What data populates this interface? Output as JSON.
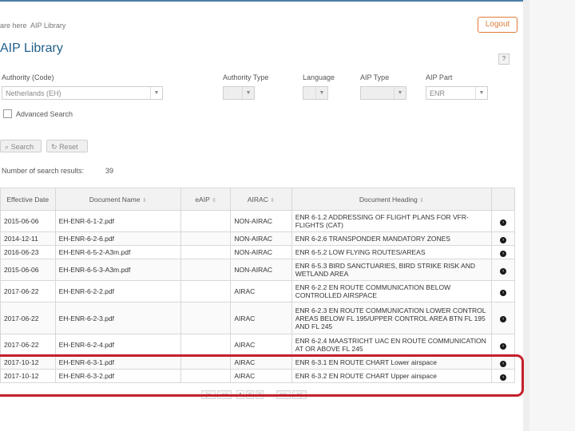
{
  "breadcrumb": {
    "prefix": "are here",
    "current": "AIP Library"
  },
  "header": {
    "logout_label": "Logout",
    "help_label": "?"
  },
  "page": {
    "title": "AIP Library"
  },
  "filters": {
    "authority": {
      "label": "Authority (Code)",
      "value": "Netherlands (EH)"
    },
    "authority_type": {
      "label": "Authority Type",
      "value": ""
    },
    "language": {
      "label": "Language",
      "value": ""
    },
    "aip_type": {
      "label": "AIP Type",
      "value": ""
    },
    "aip_part": {
      "label": "AIP Part",
      "value": "ENR"
    },
    "advanced_search_label": "Advanced Search"
  },
  "actions": {
    "search_label": "Search",
    "reset_label": "Reset"
  },
  "results": {
    "label": "Number of search results:",
    "count": "39"
  },
  "table": {
    "headers": [
      "Effective Date",
      "Document Name",
      "eAIP",
      "AIRAC",
      "Document Heading"
    ],
    "rows": [
      {
        "date": "2015-06-06",
        "doc": "EH-ENR-6-1-2.pdf",
        "eaip": "",
        "airac": "NON-AIRAC",
        "heading": "ENR 6-1.2 ADDRESSING OF FLIGHT PLANS FOR VFR-FLIGHTS (CAT)"
      },
      {
        "date": "2014-12-11",
        "doc": "EH-ENR-6-2-6.pdf",
        "eaip": "",
        "airac": "NON-AIRAC",
        "heading": "ENR 6-2.6 TRANSPONDER MANDATORY ZONES"
      },
      {
        "date": "2016-06-23",
        "doc": "EH-ENR-6-5-2-A3m.pdf",
        "eaip": "",
        "airac": "NON-AIRAC",
        "heading": "ENR 6-5.2 LOW FLYING ROUTES/AREAS"
      },
      {
        "date": "2015-06-06",
        "doc": "EH-ENR-6-5-3-A3m.pdf",
        "eaip": "",
        "airac": "NON-AIRAC",
        "heading": "ENR 6-5.3 BIRD SANCTUARIES, BIRD STRIKE RISK AND WETLAND AREA"
      },
      {
        "date": "2017-06-22",
        "doc": "EH-ENR-6-2-2.pdf",
        "eaip": "",
        "airac": "AIRAC",
        "heading": "ENR 6-2.2 EN ROUTE COMMUNICATION BELOW CONTROLLED AIRSPACE"
      },
      {
        "date": "2017-06-22",
        "doc": "EH-ENR-6-2-3.pdf",
        "eaip": "",
        "airac": "AIRAC",
        "heading": "ENR 6-2.3 EN ROUTE COMMUNICATION LOWER CONTROL AREAS BELOW FL 195/UPPER CONTROL AREA BTN FL 195 AND FL 245"
      },
      {
        "date": "2017-06-22",
        "doc": "EH-ENR-6-2-4.pdf",
        "eaip": "",
        "airac": "AIRAC",
        "heading": "ENR 6-2.4 MAASTRICHT UAC EN ROUTE COMMUNICATION AT OR ABOVE FL 245"
      },
      {
        "date": "2017-10-12",
        "doc": "EH-ENR-6-3-1.pdf",
        "eaip": "",
        "airac": "AIRAC",
        "heading": "ENR 6-3.1 EN ROUTE CHART Lower airspace"
      },
      {
        "date": "2017-10-12",
        "doc": "EH-ENR-6-3-2.pdf",
        "eaip": "",
        "airac": "AIRAC",
        "heading": "ENR 6-3.2 EN ROUTE CHART Upper airspace"
      }
    ]
  },
  "pagination": {
    "first": "|<",
    "prev": "<<",
    "pages": [
      "1",
      "2",
      "3"
    ],
    "next": ">>",
    "last": ">|",
    "current": "1"
  },
  "colors": {
    "accent": "#1f5f8b",
    "logout": "#e07b39",
    "highlight": "#c4202a"
  },
  "icons": {
    "row_action": "chevron-right-circle-icon",
    "sort": "sort-icon",
    "search": "search-icon",
    "reset": "reset-icon"
  }
}
